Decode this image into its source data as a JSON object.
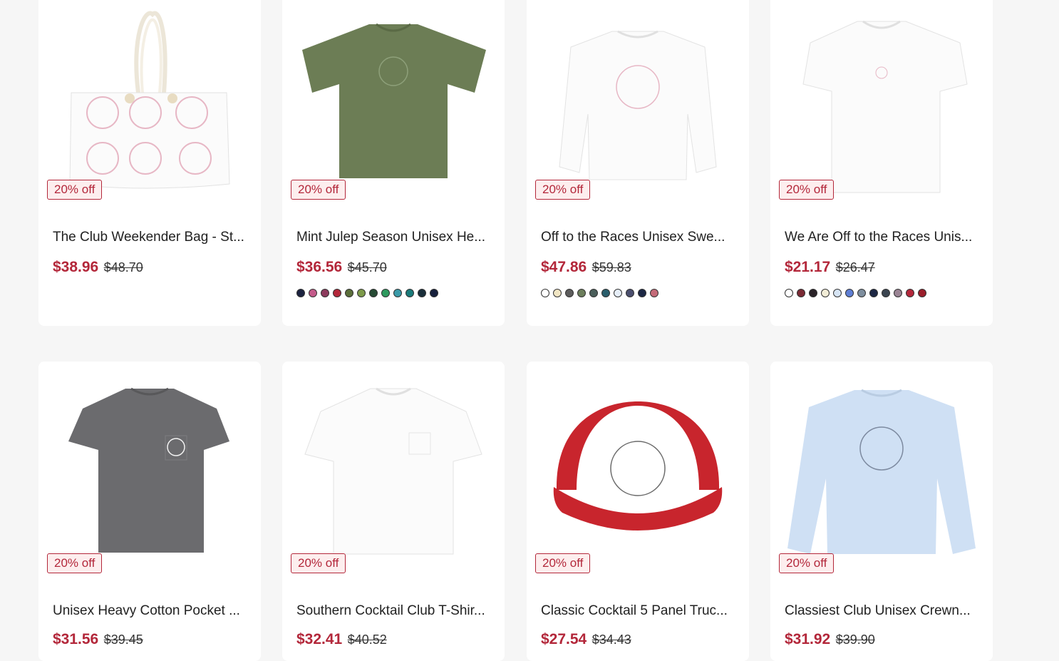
{
  "products": [
    {
      "title": "The Club Weekender Bag - St...",
      "price": "$38.96",
      "old_price": "$48.70",
      "badge": "20% off",
      "swatches": []
    },
    {
      "title": "Mint Julep Season Unisex He...",
      "price": "$36.56",
      "old_price": "$45.70",
      "badge": "20% off",
      "swatches": [
        "#1c2340",
        "#c45a8a",
        "#8c3a5c",
        "#b3273a",
        "#5a6e3a",
        "#7d9a4a",
        "#264a34",
        "#2e9a5e",
        "#3a9aa8",
        "#1a7a7a",
        "#1a2e3a",
        "#16203c"
      ]
    },
    {
      "title": "Off to the Races Unisex Swe...",
      "price": "$47.86",
      "old_price": "$59.83",
      "badge": "20% off",
      "swatches": [
        "#ffffff",
        "#f1e6c4",
        "#5c5c5c",
        "#6c7e5c",
        "#4a5e5a",
        "#2a5e6c",
        "#e6eef8",
        "#4a4e6e",
        "#1c2744",
        "#c46a78"
      ]
    },
    {
      "title": "We Are Off to the Races Unis...",
      "price": "$21.17",
      "old_price": "$26.47",
      "badge": "20% off",
      "swatches": [
        "#ffffff",
        "#7a2a34",
        "#2a2228",
        "#f1ecd6",
        "#d6e4f4",
        "#5e7ed4",
        "#7e8e9e",
        "#1c2744",
        "#3a4450",
        "#9a8494",
        "#b3273a",
        "#9a1e2a"
      ]
    },
    {
      "title": "Unisex Heavy Cotton Pocket ...",
      "price": "$31.56",
      "old_price": "$39.45",
      "badge": "20% off",
      "swatches": []
    },
    {
      "title": "Southern Cocktail Club T-Shir...",
      "price": "$32.41",
      "old_price": "$40.52",
      "badge": "20% off",
      "swatches": []
    },
    {
      "title": "Classic Cocktail 5 Panel Truc...",
      "price": "$27.54",
      "old_price": "$34.43",
      "badge": "20% off",
      "swatches": []
    },
    {
      "title": "Classiest Club Unisex Crewn...",
      "price": "$31.92",
      "old_price": "$39.90",
      "badge": "20% off",
      "swatches": []
    }
  ]
}
